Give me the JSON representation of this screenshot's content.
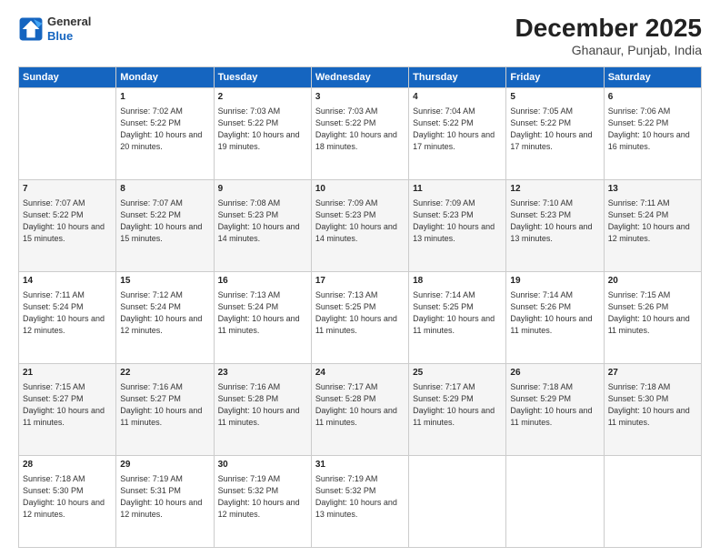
{
  "header": {
    "logo_line1": "General",
    "logo_line2": "Blue",
    "title": "December 2025",
    "subtitle": "Ghanaur, Punjab, India"
  },
  "columns": [
    "Sunday",
    "Monday",
    "Tuesday",
    "Wednesday",
    "Thursday",
    "Friday",
    "Saturday"
  ],
  "weeks": [
    [
      {
        "day": "",
        "detail": ""
      },
      {
        "day": "1",
        "detail": "Sunrise: 7:02 AM\nSunset: 5:22 PM\nDaylight: 10 hours\nand 20 minutes."
      },
      {
        "day": "2",
        "detail": "Sunrise: 7:03 AM\nSunset: 5:22 PM\nDaylight: 10 hours\nand 19 minutes."
      },
      {
        "day": "3",
        "detail": "Sunrise: 7:03 AM\nSunset: 5:22 PM\nDaylight: 10 hours\nand 18 minutes."
      },
      {
        "day": "4",
        "detail": "Sunrise: 7:04 AM\nSunset: 5:22 PM\nDaylight: 10 hours\nand 17 minutes."
      },
      {
        "day": "5",
        "detail": "Sunrise: 7:05 AM\nSunset: 5:22 PM\nDaylight: 10 hours\nand 17 minutes."
      },
      {
        "day": "6",
        "detail": "Sunrise: 7:06 AM\nSunset: 5:22 PM\nDaylight: 10 hours\nand 16 minutes."
      }
    ],
    [
      {
        "day": "7",
        "detail": "Sunrise: 7:07 AM\nSunset: 5:22 PM\nDaylight: 10 hours\nand 15 minutes."
      },
      {
        "day": "8",
        "detail": "Sunrise: 7:07 AM\nSunset: 5:22 PM\nDaylight: 10 hours\nand 15 minutes."
      },
      {
        "day": "9",
        "detail": "Sunrise: 7:08 AM\nSunset: 5:23 PM\nDaylight: 10 hours\nand 14 minutes."
      },
      {
        "day": "10",
        "detail": "Sunrise: 7:09 AM\nSunset: 5:23 PM\nDaylight: 10 hours\nand 14 minutes."
      },
      {
        "day": "11",
        "detail": "Sunrise: 7:09 AM\nSunset: 5:23 PM\nDaylight: 10 hours\nand 13 minutes."
      },
      {
        "day": "12",
        "detail": "Sunrise: 7:10 AM\nSunset: 5:23 PM\nDaylight: 10 hours\nand 13 minutes."
      },
      {
        "day": "13",
        "detail": "Sunrise: 7:11 AM\nSunset: 5:24 PM\nDaylight: 10 hours\nand 12 minutes."
      }
    ],
    [
      {
        "day": "14",
        "detail": "Sunrise: 7:11 AM\nSunset: 5:24 PM\nDaylight: 10 hours\nand 12 minutes."
      },
      {
        "day": "15",
        "detail": "Sunrise: 7:12 AM\nSunset: 5:24 PM\nDaylight: 10 hours\nand 12 minutes."
      },
      {
        "day": "16",
        "detail": "Sunrise: 7:13 AM\nSunset: 5:24 PM\nDaylight: 10 hours\nand 11 minutes."
      },
      {
        "day": "17",
        "detail": "Sunrise: 7:13 AM\nSunset: 5:25 PM\nDaylight: 10 hours\nand 11 minutes."
      },
      {
        "day": "18",
        "detail": "Sunrise: 7:14 AM\nSunset: 5:25 PM\nDaylight: 10 hours\nand 11 minutes."
      },
      {
        "day": "19",
        "detail": "Sunrise: 7:14 AM\nSunset: 5:26 PM\nDaylight: 10 hours\nand 11 minutes."
      },
      {
        "day": "20",
        "detail": "Sunrise: 7:15 AM\nSunset: 5:26 PM\nDaylight: 10 hours\nand 11 minutes."
      }
    ],
    [
      {
        "day": "21",
        "detail": "Sunrise: 7:15 AM\nSunset: 5:27 PM\nDaylight: 10 hours\nand 11 minutes."
      },
      {
        "day": "22",
        "detail": "Sunrise: 7:16 AM\nSunset: 5:27 PM\nDaylight: 10 hours\nand 11 minutes."
      },
      {
        "day": "23",
        "detail": "Sunrise: 7:16 AM\nSunset: 5:28 PM\nDaylight: 10 hours\nand 11 minutes."
      },
      {
        "day": "24",
        "detail": "Sunrise: 7:17 AM\nSunset: 5:28 PM\nDaylight: 10 hours\nand 11 minutes."
      },
      {
        "day": "25",
        "detail": "Sunrise: 7:17 AM\nSunset: 5:29 PM\nDaylight: 10 hours\nand 11 minutes."
      },
      {
        "day": "26",
        "detail": "Sunrise: 7:18 AM\nSunset: 5:29 PM\nDaylight: 10 hours\nand 11 minutes."
      },
      {
        "day": "27",
        "detail": "Sunrise: 7:18 AM\nSunset: 5:30 PM\nDaylight: 10 hours\nand 11 minutes."
      }
    ],
    [
      {
        "day": "28",
        "detail": "Sunrise: 7:18 AM\nSunset: 5:30 PM\nDaylight: 10 hours\nand 12 minutes."
      },
      {
        "day": "29",
        "detail": "Sunrise: 7:19 AM\nSunset: 5:31 PM\nDaylight: 10 hours\nand 12 minutes."
      },
      {
        "day": "30",
        "detail": "Sunrise: 7:19 AM\nSunset: 5:32 PM\nDaylight: 10 hours\nand 12 minutes."
      },
      {
        "day": "31",
        "detail": "Sunrise: 7:19 AM\nSunset: 5:32 PM\nDaylight: 10 hours\nand 13 minutes."
      },
      {
        "day": "",
        "detail": ""
      },
      {
        "day": "",
        "detail": ""
      },
      {
        "day": "",
        "detail": ""
      }
    ]
  ]
}
